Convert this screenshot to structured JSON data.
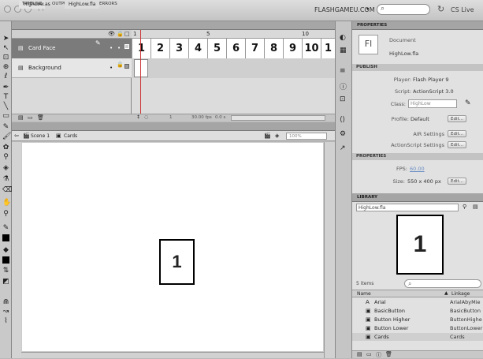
{
  "window": {
    "app_label": "Fl",
    "workspace": "FLASHGAMEU.COM",
    "cs_live": "CS Live"
  },
  "panel_tabs": [
    "TIMELINE",
    "OUTPUT",
    "COMPILER ERRORS"
  ],
  "timeline": {
    "layers": [
      {
        "name": "Card Face",
        "selected": true
      },
      {
        "name": "Background",
        "selected": false
      }
    ],
    "ruler_marks": [
      "1",
      "5",
      "10"
    ],
    "frames": [
      "1",
      "2",
      "3",
      "4",
      "5",
      "6",
      "7",
      "8",
      "9",
      "10",
      "1"
    ],
    "footer": {
      "frame": "1",
      "fps": "30.00 fps",
      "time": "0.0 s"
    }
  },
  "doc_tabs": [
    "HighLow.as",
    "HighLow.fla"
  ],
  "edit_bar": {
    "scene": "Scene 1",
    "symbol": "Cards",
    "zoom": "100%"
  },
  "stage": {
    "card_text": "1"
  },
  "properties": {
    "tab": "PROPERTIES",
    "doc_icon": "Fl",
    "doc_type": "Document",
    "doc_name": "HighLow.fla",
    "publish_section": "PUBLISH",
    "player_label": "Player:",
    "player_value": "Flash Player 9",
    "script_label": "Script:",
    "script_value": "ActionScript 3.0",
    "class_label": "Class:",
    "class_value": "HighLow",
    "profile_label": "Profile:",
    "profile_value": "Default",
    "edit_button": "Edit...",
    "air_label": "AIR Settings",
    "as_label": "ActionScript Settings",
    "properties_section": "PROPERTIES",
    "fps_label": "FPS:",
    "fps_value": "60.00",
    "size_label": "Size:",
    "size_value": "550 x 400 px"
  },
  "library": {
    "tab": "LIBRARY",
    "file": "HighLow.fla",
    "preview_text": "1",
    "count": "5 items",
    "col_name": "Name",
    "col_linkage": "Linkage",
    "items": [
      {
        "icon": "A",
        "name": "Arial",
        "linkage": "ArialAbyMie"
      },
      {
        "icon": "▣",
        "name": "BasicButton",
        "linkage": "BasicButton"
      },
      {
        "icon": "▣",
        "name": "Button Higher",
        "linkage": "ButtonHighe"
      },
      {
        "icon": "▣",
        "name": "Button Lower",
        "linkage": "ButtonLower"
      },
      {
        "icon": "▣",
        "name": "Cards",
        "linkage": "Cards"
      }
    ]
  }
}
